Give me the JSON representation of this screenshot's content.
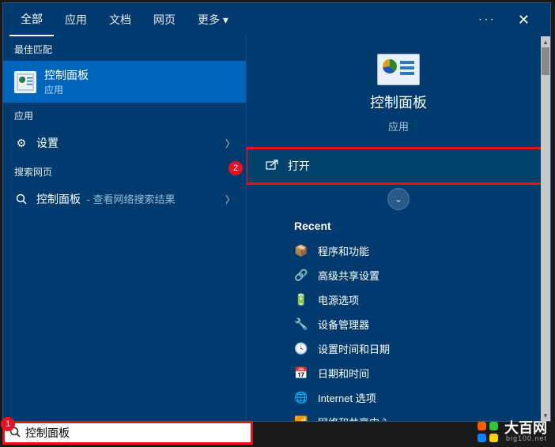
{
  "tabs": {
    "all": "全部",
    "apps": "应用",
    "docs": "文档",
    "web": "网页",
    "more": "更多"
  },
  "left": {
    "best_match_label": "最佳匹配",
    "best_match": {
      "title": "控制面板",
      "subtitle": "应用"
    },
    "apps_label": "应用",
    "settings": "设置",
    "web_label": "搜索网页",
    "web_query": "控制面板",
    "web_suffix": " - 查看网络搜索结果"
  },
  "badges": {
    "one": "1",
    "two": "2"
  },
  "detail": {
    "title": "控制面板",
    "subtitle": "应用",
    "open": "打开",
    "recent_label": "Recent",
    "recent": [
      "程序和功能",
      "高级共享设置",
      "电源选项",
      "设备管理器",
      "设置时间和日期",
      "日期和时间",
      "Internet 选项",
      "网络和共享中心"
    ]
  },
  "search": {
    "value": "控制面板"
  },
  "watermark": {
    "main": "大百网",
    "sub": "big100.net"
  }
}
